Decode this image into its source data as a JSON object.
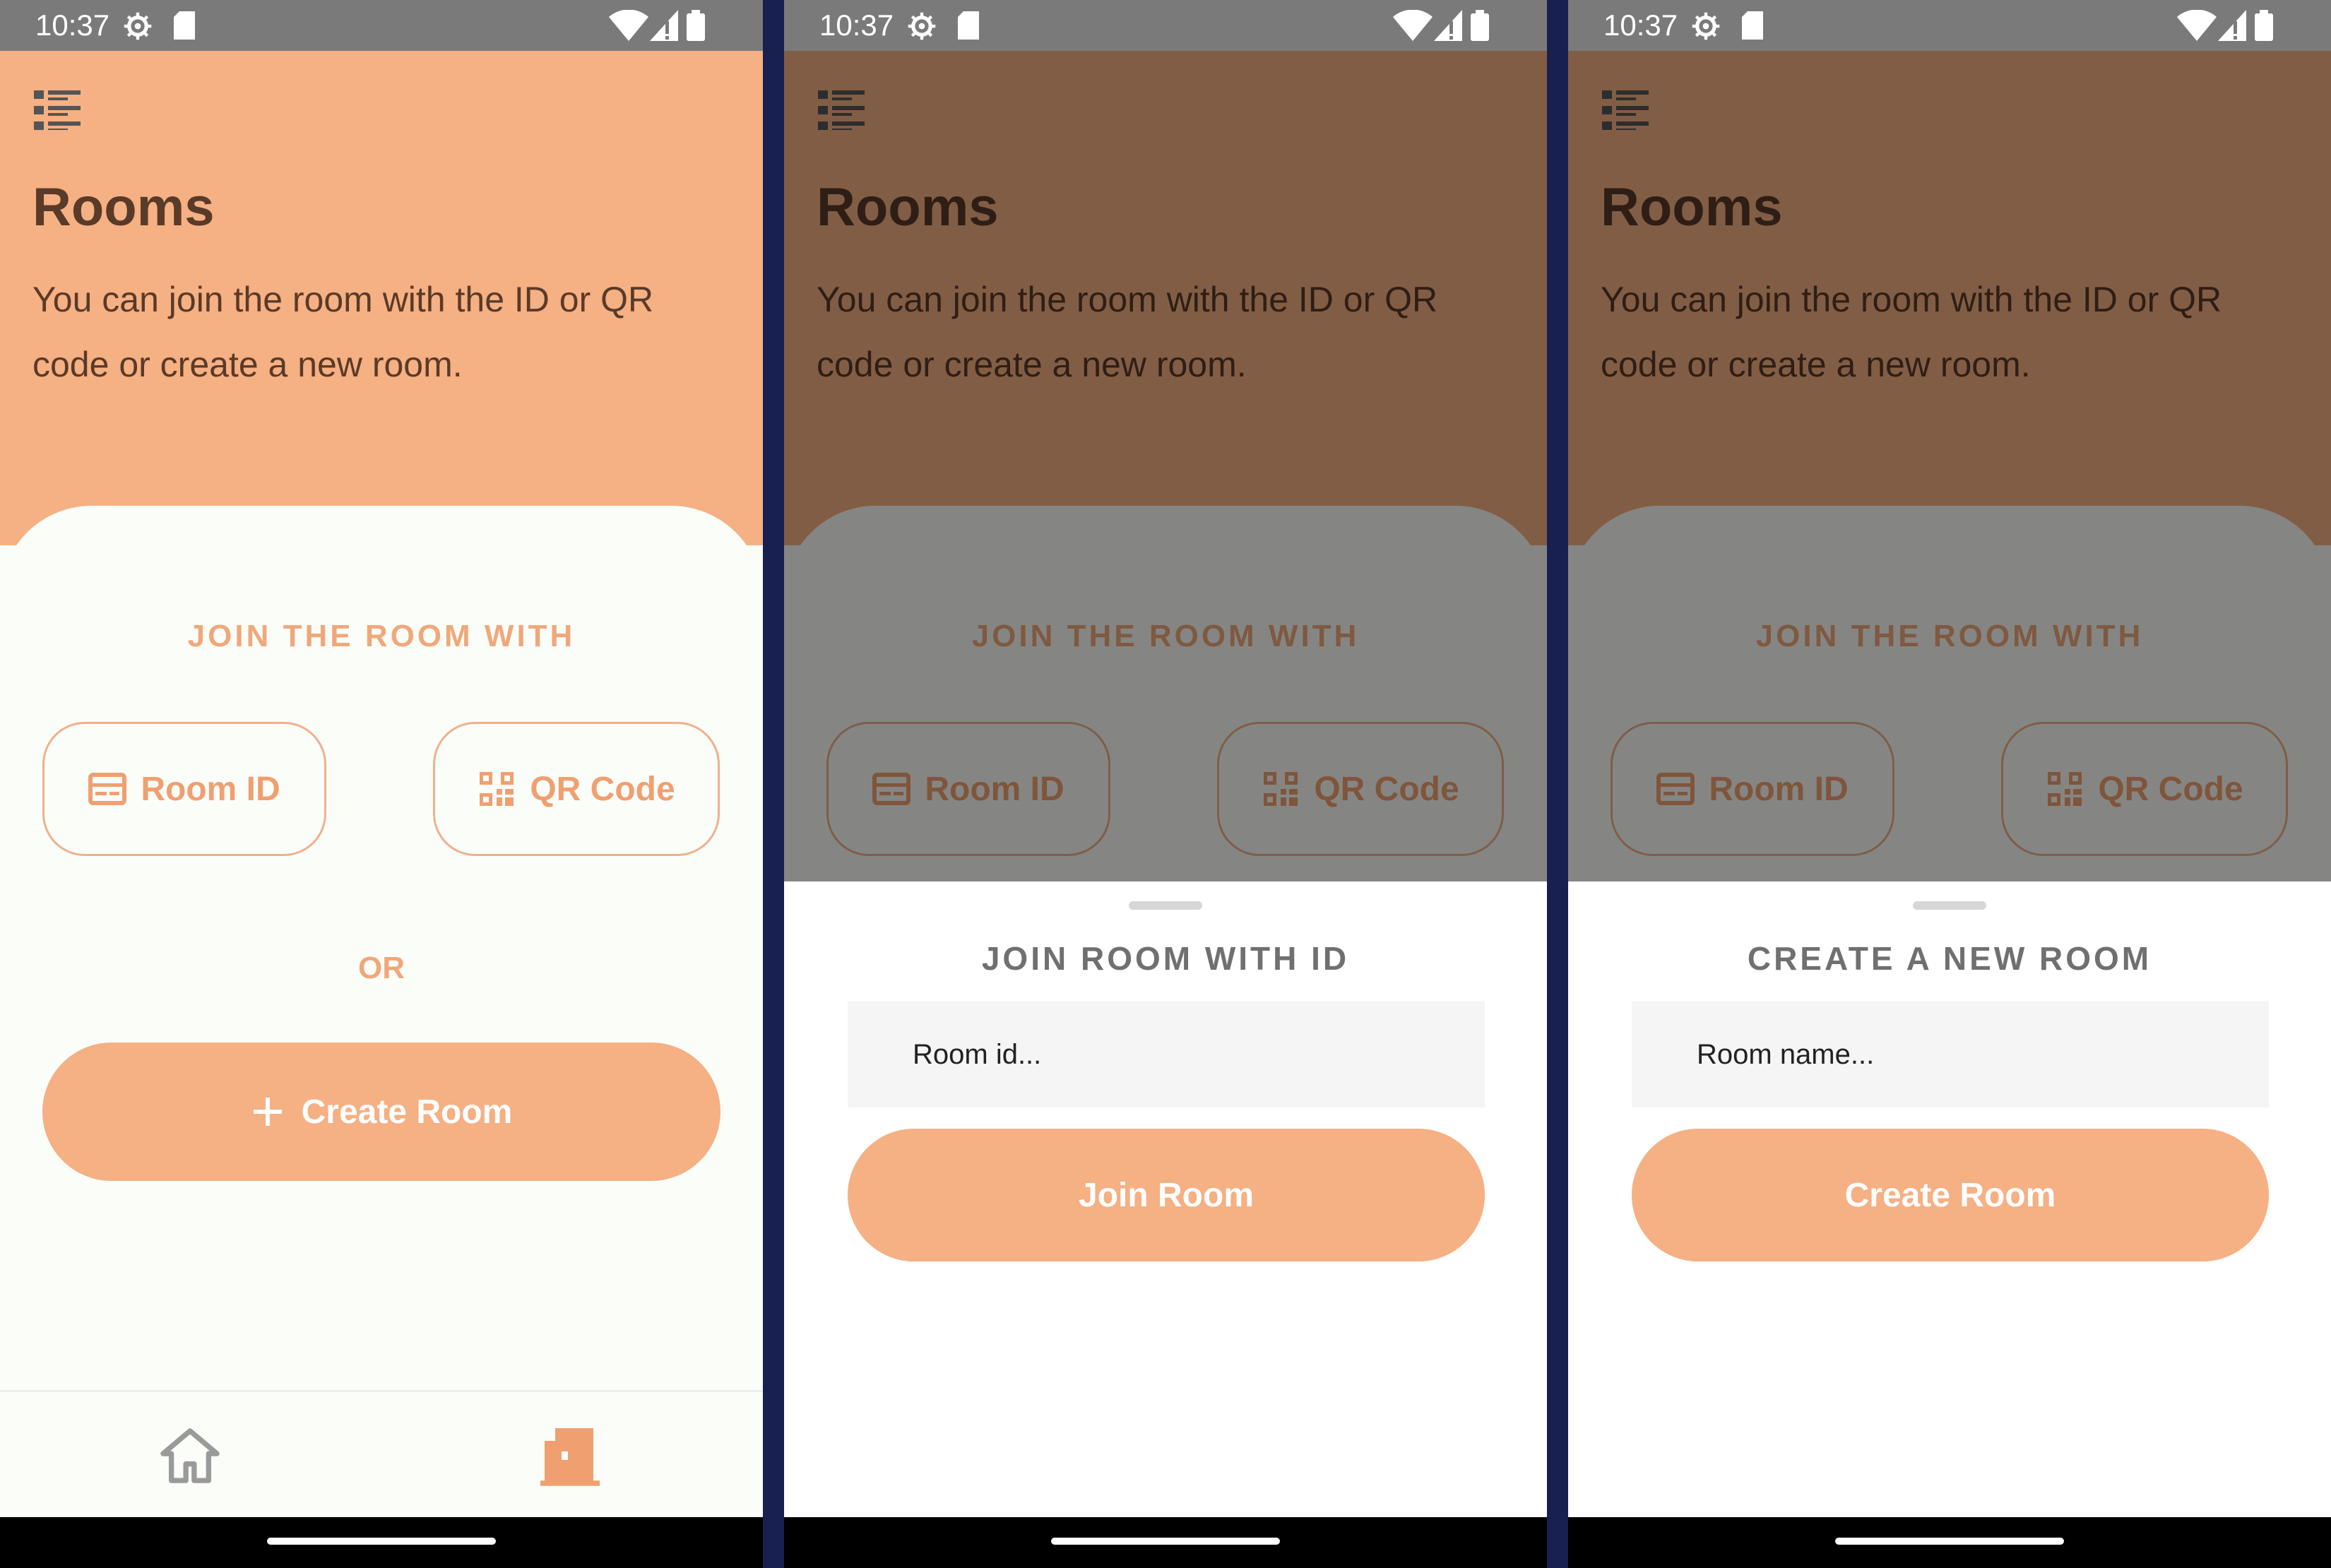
{
  "status_bar": {
    "time": "10:37"
  },
  "screen": {
    "title": "Rooms",
    "description": "You can join the room with the ID or QR code or create a new room.",
    "join_label": "JOIN THE ROOM WITH",
    "room_id_label": "Room ID",
    "qr_code_label": "QR Code",
    "or_label": "OR",
    "create_room_label": "Create Room"
  },
  "nav": {
    "items": [
      {
        "icon": "home-icon"
      },
      {
        "icon": "door-icon",
        "active": true
      }
    ]
  },
  "join_sheet": {
    "title": "JOIN ROOM WITH ID",
    "placeholder": "Room id...",
    "button_label": "Join Room"
  },
  "create_sheet": {
    "title": "CREATE A NEW ROOM",
    "placeholder": "Room name...",
    "button_label": "Create Room"
  },
  "colors": {
    "accent": "#f5b083",
    "accent_text": "#f0a070",
    "title_text": "#5a3a28",
    "background": "#fbfdf9",
    "divider": "#172050"
  }
}
